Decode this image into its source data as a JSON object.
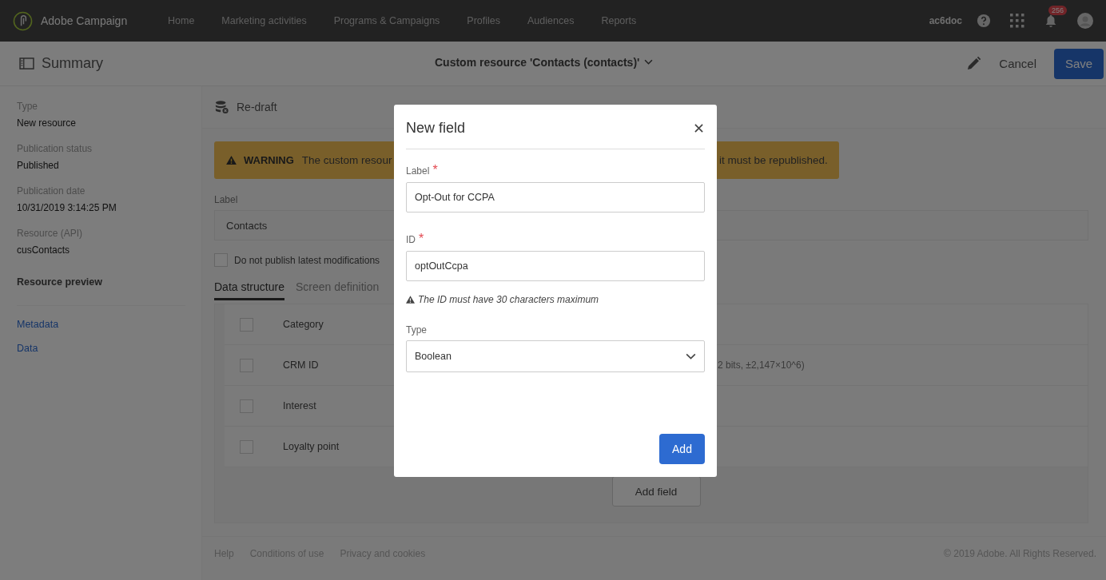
{
  "topbar": {
    "app_name": "Adobe Campaign",
    "nav": [
      "Home",
      "Marketing activities",
      "Programs & Campaigns",
      "Profiles",
      "Audiences",
      "Reports"
    ],
    "user": "ac6doc",
    "notification_count": "256"
  },
  "header": {
    "title": "Summary",
    "resource_title": "Custom resource 'Contacts (contacts)'",
    "cancel": "Cancel",
    "save": "Save"
  },
  "sidebar": {
    "fields": [
      {
        "label": "Type",
        "value": "New resource"
      },
      {
        "label": "Publication status",
        "value": "Published"
      },
      {
        "label": "Publication date",
        "value": "10/31/2019 3:14:25 PM"
      },
      {
        "label": "Resource (API)",
        "value": "cusContacts"
      }
    ],
    "section_title": "Resource preview",
    "links": [
      "Metadata",
      "Data"
    ]
  },
  "main": {
    "redraft": "Re-draft",
    "warning": {
      "label": "WARNING",
      "text_start": "The custom resour",
      "text_end": "it must be republished."
    },
    "label_field": {
      "label": "Label",
      "value": "Contacts"
    },
    "checkbox": {
      "label": "Do not publish latest modifications",
      "checked": false
    },
    "tabs": [
      {
        "label": "Data structure",
        "selected": true
      },
      {
        "label": "Screen definition",
        "selected": false
      }
    ],
    "fields": [
      {
        "name": "Category",
        "checked": false
      },
      {
        "name": "CRM ID",
        "column_3": "2 bits, ±2,147×10^6)",
        "checked": false
      },
      {
        "name": "Interest",
        "checked": false
      },
      {
        "name": "Loyalty point",
        "checked": false
      }
    ],
    "add_field": "Add field"
  },
  "footer": {
    "links": [
      "Help",
      "Conditions of use",
      "Privacy and cookies"
    ],
    "copyright": "© 2019 Adobe. All Rights Reserved."
  },
  "modal": {
    "title": "New field",
    "label_field": {
      "label": "Label",
      "required_mark": "*",
      "value": "Opt-Out for CCPA"
    },
    "id_field": {
      "label": "ID",
      "required_mark": "*",
      "value": "optOutCcpa"
    },
    "hint": "The ID must have 30 characters maximum",
    "type_field": {
      "label": "Type",
      "value": "Boolean"
    },
    "add": "Add"
  }
}
